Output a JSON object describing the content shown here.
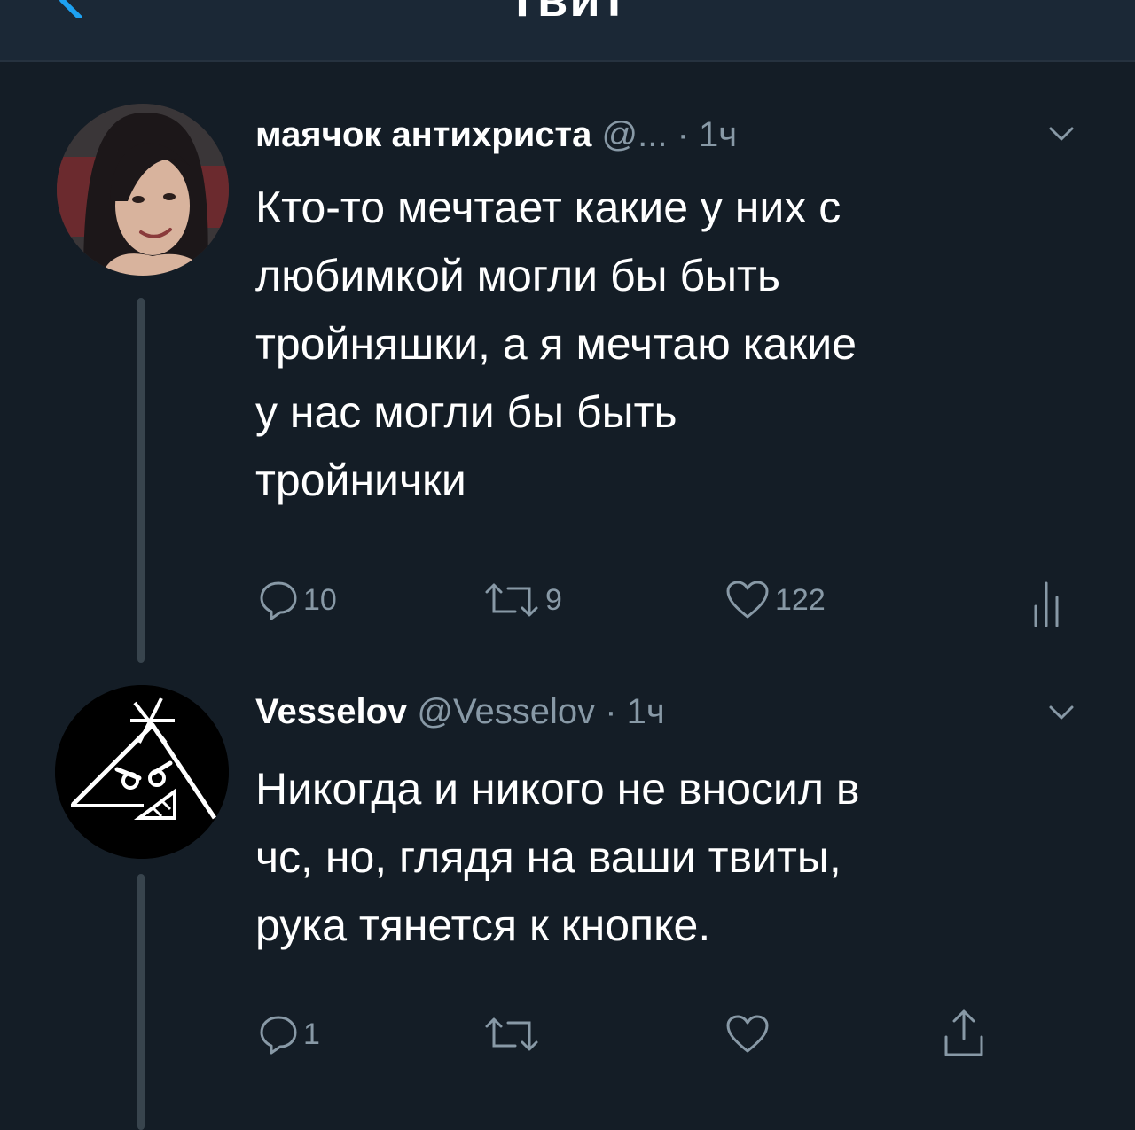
{
  "header": {
    "title": "Твит"
  },
  "tweets": [
    {
      "display_name": "маячок антихриста",
      "handle": "@...",
      "time": " · 1ч",
      "text": "Кто-то мечтает какие у них с\nлюбимкой могли бы быть\nтройняшки, а я мечтаю какие\nу нас могли бы быть\nтройнички",
      "reply_count": "10",
      "retweet_count": "9",
      "like_count": "122",
      "icons": {
        "reply": "reply-icon",
        "retweet": "retweet-icon",
        "like": "heart-icon",
        "extra": "analytics-icon",
        "menu": "chevron-down-icon"
      }
    },
    {
      "display_name": "Vesselov",
      "handle": "@Vesselov",
      "time": " · 1ч",
      "text": "Никогда и никого не вносил в\nчс, но, глядя на ваши твиты,\nрука тянется к кнопке.",
      "reply_count": "1",
      "retweet_count": "",
      "like_count": "",
      "icons": {
        "reply": "reply-icon",
        "retweet": "retweet-icon",
        "like": "heart-icon",
        "extra": "share-icon",
        "menu": "chevron-down-icon"
      }
    }
  ],
  "colors": {
    "background": "#141d26",
    "header_background": "#1b2836",
    "text_primary": "#ffffff",
    "text_secondary": "#8899a6",
    "thread_line": "#38444d"
  }
}
